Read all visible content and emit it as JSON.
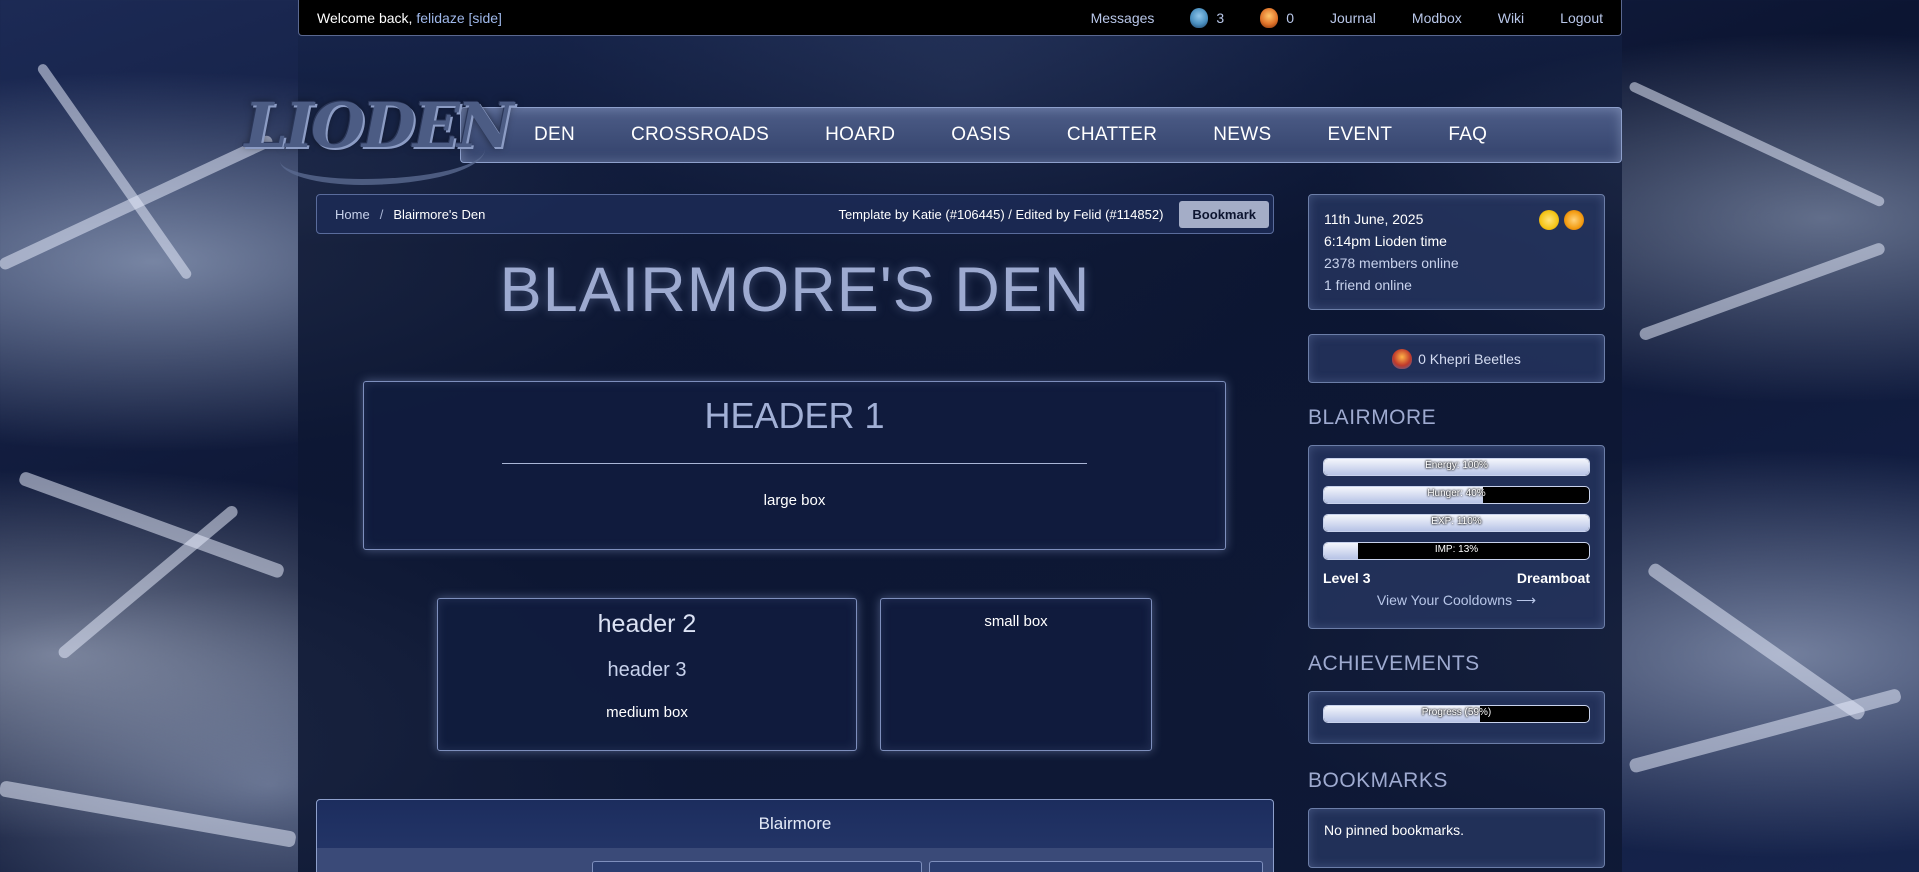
{
  "topbar": {
    "welcome_prefix": "Welcome back,",
    "username": "felidaze [side]",
    "messages": "Messages",
    "beetles_count": "3",
    "bugs_count": "0",
    "links": [
      "Journal",
      "Modbox",
      "Wiki",
      "Logout"
    ]
  },
  "logo": {
    "text": "LIODEN"
  },
  "nav": {
    "items": [
      "DEN",
      "CROSSROADS",
      "HOARD",
      "OASIS",
      "CHATTER",
      "NEWS",
      "EVENT",
      "FAQ"
    ]
  },
  "breadcrumb": {
    "home": "Home",
    "separator": "/",
    "current": "Blairmore's Den",
    "credit": "Template by Katie (#106445) / Edited by Felid (#114852)",
    "bookmark_label": "Bookmark"
  },
  "den_title": "BLAIRMORE'S DEN",
  "large_box": {
    "header": "HEADER 1",
    "text": "large box"
  },
  "medium_box": {
    "header2": "header 2",
    "header3": "header 3",
    "text": "medium box"
  },
  "small_box": {
    "text": "small box"
  },
  "blairmore_panel": {
    "title": "Blairmore"
  },
  "sidebar": {
    "info": {
      "date": "11th June, 2025",
      "time": "6:14pm Lioden time",
      "members_online": "2378 members online",
      "friends_online": "1 friend online"
    },
    "khepri": "0 Khepri Beetles",
    "lion_name": "BLAIRMORE",
    "stats": [
      {
        "label": "Energy: 100%",
        "value": 100
      },
      {
        "label": "Hunger: 40%",
        "value": 60
      },
      {
        "label": "EXP: 110%",
        "value": 100
      },
      {
        "label": "IMP: 13%",
        "value": 13
      }
    ],
    "level": "Level 3",
    "title": "Dreamboat",
    "cooldowns": "View Your Cooldowns ⟶",
    "achievements_head": "ACHIEVEMENTS",
    "achievements_progress": {
      "label": "Progress (59%)",
      "value": 59
    },
    "bookmarks_head": "BOOKMARKS",
    "bookmarks_text": "No pinned bookmarks."
  },
  "colors": {
    "accent": "#8ea0cc",
    "bar_fill": "#c8d2ec",
    "beetle": "#4a8fbf",
    "bug": "#e0742a",
    "sun": "#f5c518"
  }
}
